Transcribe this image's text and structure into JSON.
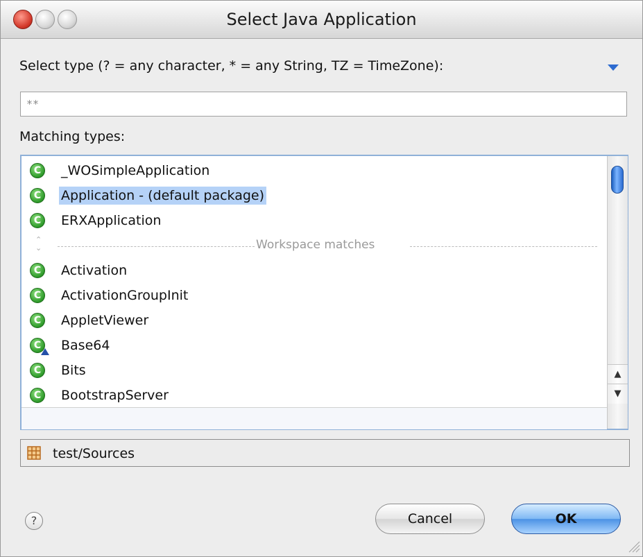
{
  "window": {
    "title": "Select Java Application"
  },
  "filter": {
    "label": "Select type (? = any character, * = any String, TZ = TimeZone):",
    "value": "**"
  },
  "matching": {
    "label": "Matching types:",
    "items": [
      {
        "label": "_WOSimpleApplication",
        "icon": "class-icon"
      },
      {
        "label": "Application - (default package)",
        "icon": "class-icon",
        "selected": true
      },
      {
        "label": "ERXApplication",
        "icon": "class-icon"
      },
      {
        "separator": "Workspace matches"
      },
      {
        "label": "Activation",
        "icon": "class-icon"
      },
      {
        "label": "ActivationGroupInit",
        "icon": "class-icon"
      },
      {
        "label": "AppletViewer",
        "icon": "class-icon"
      },
      {
        "label": "Base64",
        "icon": "class-warning-icon"
      },
      {
        "label": "Bits",
        "icon": "class-icon"
      },
      {
        "label": "BootstrapServer",
        "icon": "class-icon"
      }
    ]
  },
  "location": {
    "label": "test/Sources",
    "icon": "package-folder-icon"
  },
  "buttons": {
    "help": "?",
    "cancel": "Cancel",
    "ok": "OK"
  },
  "colors": {
    "selection": "#b5d2f7",
    "accent": "#2d6bd0",
    "class_icon": "#2e9a2a"
  }
}
